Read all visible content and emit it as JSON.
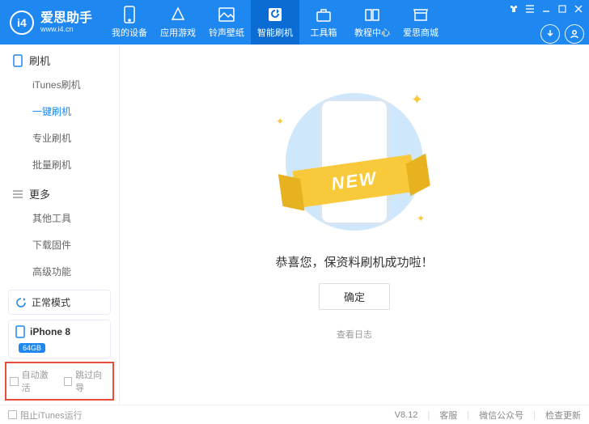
{
  "app": {
    "name": "爱思助手",
    "url": "www.i4.cn",
    "logo_text": "i4"
  },
  "nav": [
    {
      "label": "我的设备",
      "active": false
    },
    {
      "label": "应用游戏",
      "active": false
    },
    {
      "label": "铃声壁纸",
      "active": false
    },
    {
      "label": "智能刷机",
      "active": true
    },
    {
      "label": "工具箱",
      "active": false
    },
    {
      "label": "教程中心",
      "active": false
    },
    {
      "label": "爱思商城",
      "active": false
    }
  ],
  "sidebar": {
    "groups": [
      {
        "title": "刷机",
        "items": [
          {
            "label": "iTunes刷机",
            "active": false
          },
          {
            "label": "一键刷机",
            "active": true
          },
          {
            "label": "专业刷机",
            "active": false
          },
          {
            "label": "批量刷机",
            "active": false
          }
        ]
      },
      {
        "title": "更多",
        "items": [
          {
            "label": "其他工具",
            "active": false
          },
          {
            "label": "下载固件",
            "active": false
          },
          {
            "label": "高级功能",
            "active": false
          }
        ]
      }
    ],
    "mode": "正常模式",
    "device": {
      "model": "iPhone 8",
      "storage": "64GB"
    },
    "checks": [
      {
        "label": "自动激活"
      },
      {
        "label": "跳过向导"
      }
    ]
  },
  "main": {
    "ribbon": "NEW",
    "message": "恭喜您，保资料刷机成功啦！",
    "ok": "确定",
    "view_log": "查看日志"
  },
  "status": {
    "block_itunes": "阻止iTunes运行",
    "version": "V8.12",
    "support": "客服",
    "wechat": "微信公众号",
    "update": "检查更新"
  }
}
